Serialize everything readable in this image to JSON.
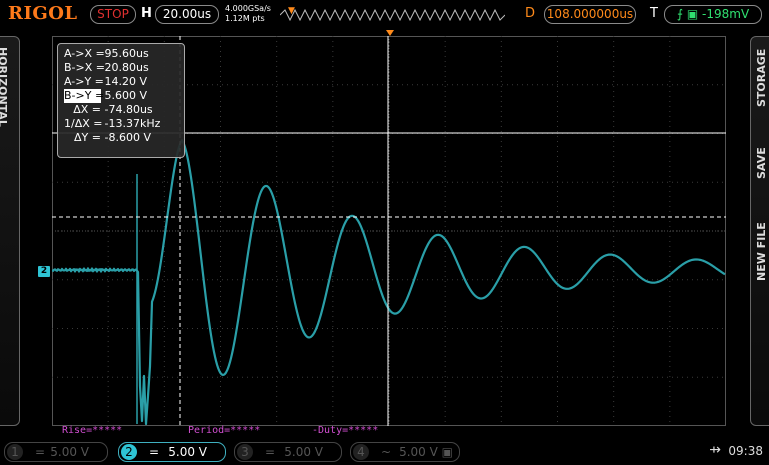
{
  "topbar": {
    "logo": "RIGOL",
    "run_state": "STOP",
    "h_label": "H",
    "timebase": "20.00us",
    "sample_rate": "4.000GSa/s",
    "mem_depth": "1.12M pts",
    "d_label": "D",
    "delay": "108.000000us",
    "t_label": "T",
    "trigger_level": "-198mV"
  },
  "side": {
    "left_tab": "HORIZONTAL",
    "right_tabs": [
      "STORAGE",
      "SAVE",
      "NEW FILE"
    ]
  },
  "cursor": {
    "rows": [
      {
        "key": "A->X =",
        "value": "95.60us",
        "selected": false
      },
      {
        "key": "B->X =",
        "value": "20.80us",
        "selected": false
      },
      {
        "key": "A->Y =",
        "value": "14.20 V",
        "selected": false
      },
      {
        "key": "B->Y =",
        "value": "5.600 V",
        "selected": true
      },
      {
        "key": "ΔX =",
        "value": "-74.80us",
        "selected": false
      },
      {
        "key": "1/ΔX =",
        "value": "-13.37kHz",
        "selected": false
      },
      {
        "key": "ΔY =",
        "value": "-8.600 V",
        "selected": false
      }
    ]
  },
  "measurements": {
    "rise": "Rise=*****",
    "period": "Period=*****",
    "duty": "-Duty=*****"
  },
  "channels": [
    {
      "num": "1",
      "coupling": "=",
      "scale": "5.00 V",
      "active": false
    },
    {
      "num": "2",
      "coupling": "=",
      "scale": "5.00 V",
      "active": true
    },
    {
      "num": "3",
      "coupling": "=",
      "scale": "5.00 V",
      "active": false
    },
    {
      "num": "4",
      "coupling": "~",
      "scale": "5.00 V",
      "active": false
    }
  ],
  "status": {
    "time": "09:38"
  },
  "ch2_marker": "2",
  "colors": {
    "trace": "#2a9fa8",
    "cursor_lines": "#ffffff",
    "trigger": "#ff8a1a",
    "measurement": "#d24fd2"
  }
}
